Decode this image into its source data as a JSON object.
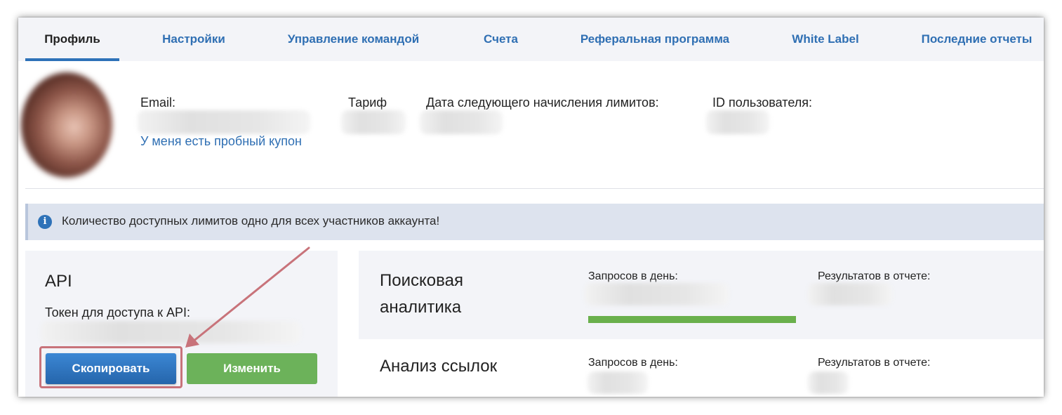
{
  "tabs": [
    {
      "label": "Профиль",
      "active": true
    },
    {
      "label": "Настройки"
    },
    {
      "label": "Управление командой"
    },
    {
      "label": "Счета"
    },
    {
      "label": "Реферальная программа"
    },
    {
      "label": "White Label"
    },
    {
      "label": "Последние отчеты"
    }
  ],
  "profile": {
    "email_label": "Email:",
    "tariff_label": "Тариф",
    "next_limit_label": "Дата следующего начисления лимитов:",
    "user_id_label": "ID пользователя:",
    "coupon_link": "У меня есть пробный купон"
  },
  "banner": {
    "icon": "info-icon",
    "icon_glyph": "i",
    "text": "Количество доступных лимитов одно для всех участников аккаунта!"
  },
  "api": {
    "title": "API",
    "token_label": "Токен для доступа к API:",
    "copy_button": "Скопировать",
    "edit_button": "Изменить"
  },
  "stats": [
    {
      "title_line1": "Поисковая",
      "title_line2": "аналитика",
      "requests_label": "Запросов в день:",
      "results_label": "Результатов в отчете:",
      "usage_fraction": 1.0
    },
    {
      "title_line1": "Анализ ссылок",
      "requests_label": "Запросов в день:",
      "results_label": "Результатов в отчете:"
    }
  ],
  "colors": {
    "link": "#2f6fb3",
    "tab_underline": "#2e72b8",
    "copy_button": "#2e72b8",
    "edit_button": "#6cb25a",
    "progress": "#6ab04c",
    "annotation": "#c8737a",
    "banner_bg": "#dde3ee"
  }
}
